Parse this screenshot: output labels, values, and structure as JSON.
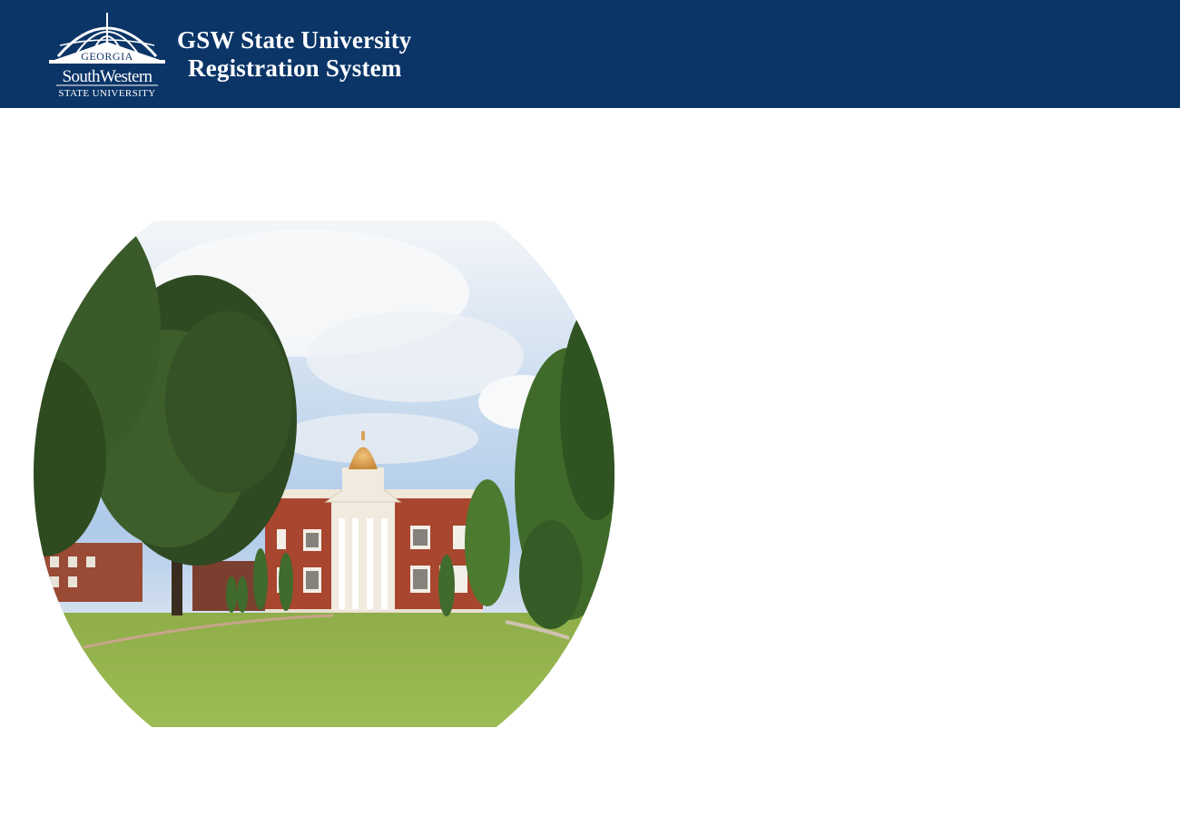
{
  "header": {
    "title_line1": "GSW State University",
    "title_line2": "Registration System",
    "background_color": "#0b3567"
  },
  "logo": {
    "text_top": "GEORGIA",
    "text_main": "SouthWestern",
    "text_bottom": "STATE UNIVERSITY",
    "icon": "dome-logo-icon"
  },
  "hero": {
    "icon": "campus-building-image"
  }
}
